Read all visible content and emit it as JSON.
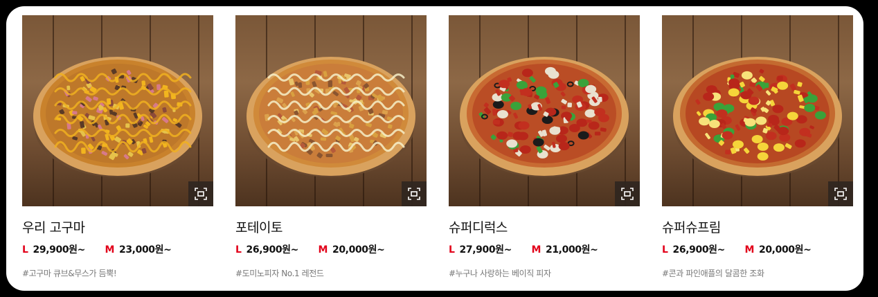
{
  "menu": {
    "zoom_icon": "zoom-expand-icon",
    "colors": {
      "size_label": "#e2001a",
      "text": "#111111",
      "tag": "#777777"
    },
    "items": [
      {
        "name": "우리 고구마",
        "sizes": [
          {
            "label": "L",
            "price": "29,900원~"
          },
          {
            "label": "M",
            "price": "23,000원~"
          }
        ],
        "tag": "#고구마 큐브&무스가 듬뿍!",
        "topping_theme": "sweet-potato"
      },
      {
        "name": "포테이토",
        "sizes": [
          {
            "label": "L",
            "price": "26,900원~"
          },
          {
            "label": "M",
            "price": "20,000원~"
          }
        ],
        "tag": "#도미노피자 No.1 레전드",
        "topping_theme": "potato"
      },
      {
        "name": "슈퍼디럭스",
        "sizes": [
          {
            "label": "L",
            "price": "27,900원~"
          },
          {
            "label": "M",
            "price": "21,000원~"
          }
        ],
        "tag": "#누구나 사랑하는 베이직 피자",
        "topping_theme": "supreme"
      },
      {
        "name": "슈퍼슈프림",
        "sizes": [
          {
            "label": "L",
            "price": "26,900원~"
          },
          {
            "label": "M",
            "price": "20,000원~"
          }
        ],
        "tag": "#콘과 파인애플의 달콤한 조화",
        "topping_theme": "pineapple"
      }
    ]
  }
}
